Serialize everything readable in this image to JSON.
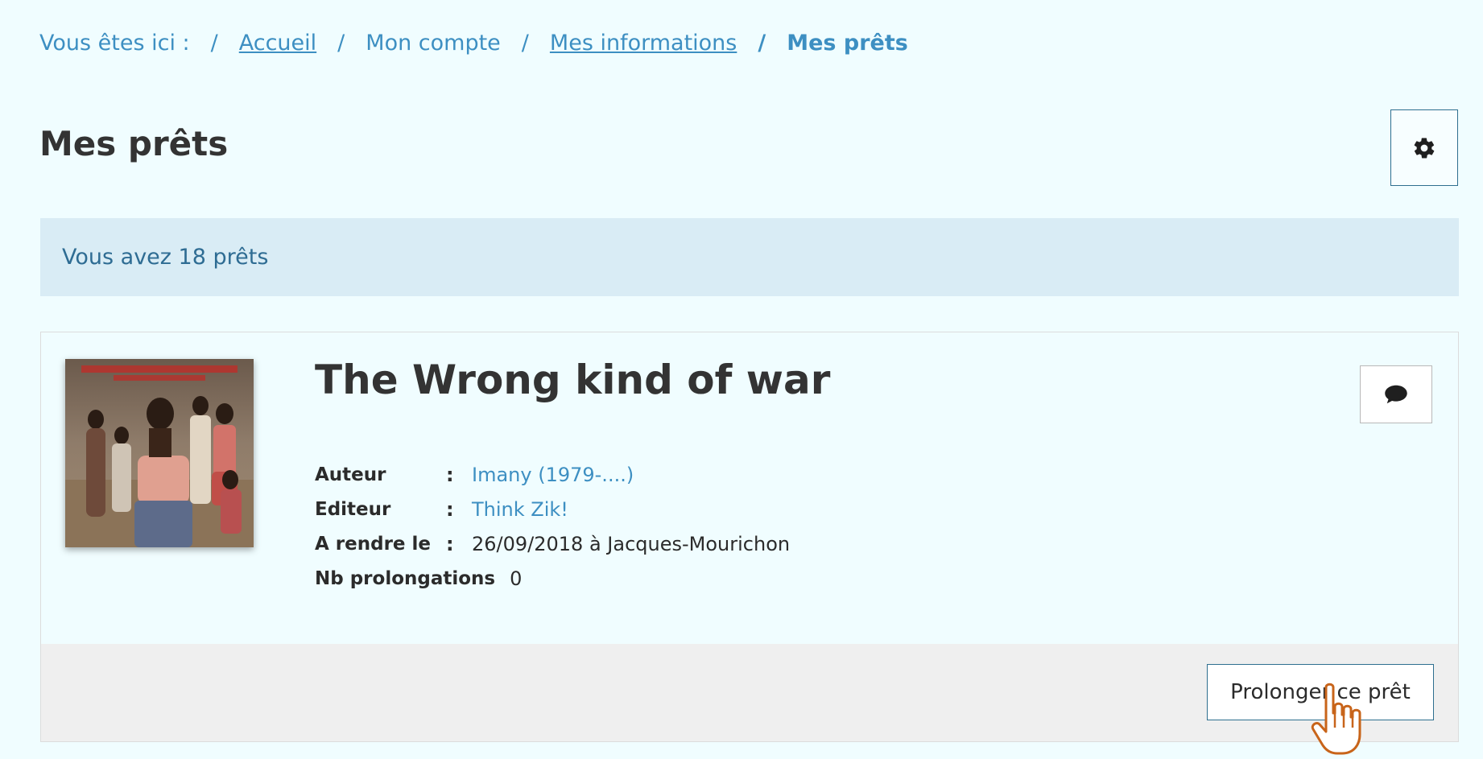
{
  "breadcrumb": {
    "prefix": "Vous êtes ici :",
    "separator": "/",
    "items": [
      "Accueil",
      "Mon compte",
      "Mes informations"
    ],
    "current": "Mes prêts"
  },
  "page": {
    "title": "Mes prêts",
    "settings_icon": "gear-icon"
  },
  "info": {
    "message": "Vous avez 18 prêts"
  },
  "loan": {
    "title": "The Wrong kind of war",
    "cover_icon": "album-cover",
    "comment_icon": "speech-bubble-icon",
    "fields": {
      "author_label": "Auteur",
      "author_value": "Imany (1979-....)",
      "publisher_label": "Editeur",
      "publisher_value": "Think Zik!",
      "due_label": "A rendre le",
      "due_value": "26/09/2018 à Jacques-Mourichon",
      "renewals_label": "Nb prolongations",
      "renewals_value": "0",
      "colon": ":"
    },
    "renew_label": "Prolonger ce prêt"
  },
  "colors": {
    "link": "#3d8fc2",
    "background": "#f0fdff",
    "info_bar": "#d9ecf5",
    "cursor": "#c8641a"
  }
}
